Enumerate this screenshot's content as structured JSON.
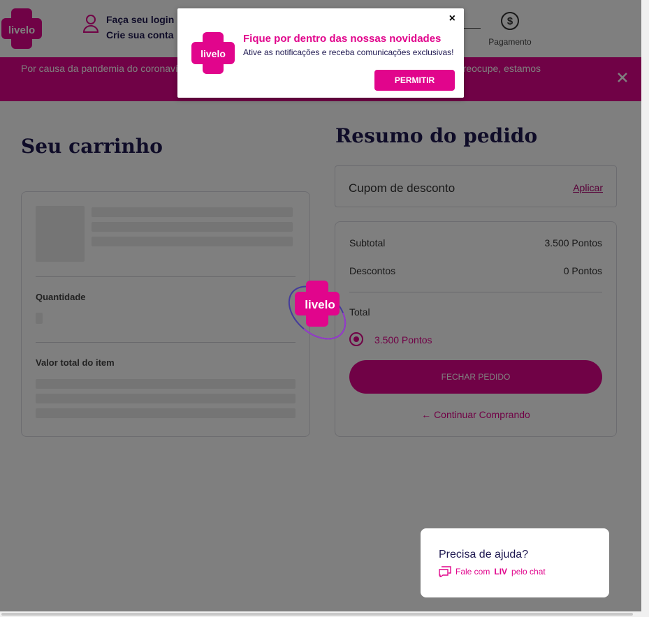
{
  "brand": {
    "logo_text": "livelo",
    "accent": "#e1058c",
    "navy": "#1e1850"
  },
  "header": {
    "login_title": "Faça seu login",
    "signup": "Crie sua conta",
    "user_icon": "user-icon",
    "payment_step_label": "Pagamento",
    "payment_icon": "dollar-circle-icon"
  },
  "banner": {
    "text": "Por causa da pandemia do coronavírus, as entregas dos pedidos podem sofrer atrasos. Mas não se preocupe, estamos",
    "close_icon": "close-icon"
  },
  "cart": {
    "title": "Seu carrinho",
    "quantity_label": "Quantidade",
    "item_total_label": "Valor total do item"
  },
  "summary": {
    "title": "Resumo do pedido",
    "coupon_label": "Cupom de desconto",
    "coupon_action": "Aplicar",
    "subtotal_label": "Subtotal",
    "subtotal_value": "3.500 Pontos",
    "discount_label": "Descontos",
    "discount_value": "0 Pontos",
    "total_label": "Total",
    "total_option": "3.500 Pontos",
    "close_order": "FECHAR PEDIDO",
    "continue": "Continuar Comprando",
    "continue_icon": "arrow-left-icon"
  },
  "popup": {
    "title": "Fique por dentro das nossas novidades",
    "message": "Ative as notificações e receba comunicações exclusivas!",
    "allow": "PERMITIR",
    "close": "×"
  },
  "help": {
    "question": "Precisa de ajuda?",
    "chat_prefix": "Fale com",
    "chat_agent": "LIV",
    "chat_suffix": "pelo chat",
    "chat_icon": "chat-icon"
  }
}
